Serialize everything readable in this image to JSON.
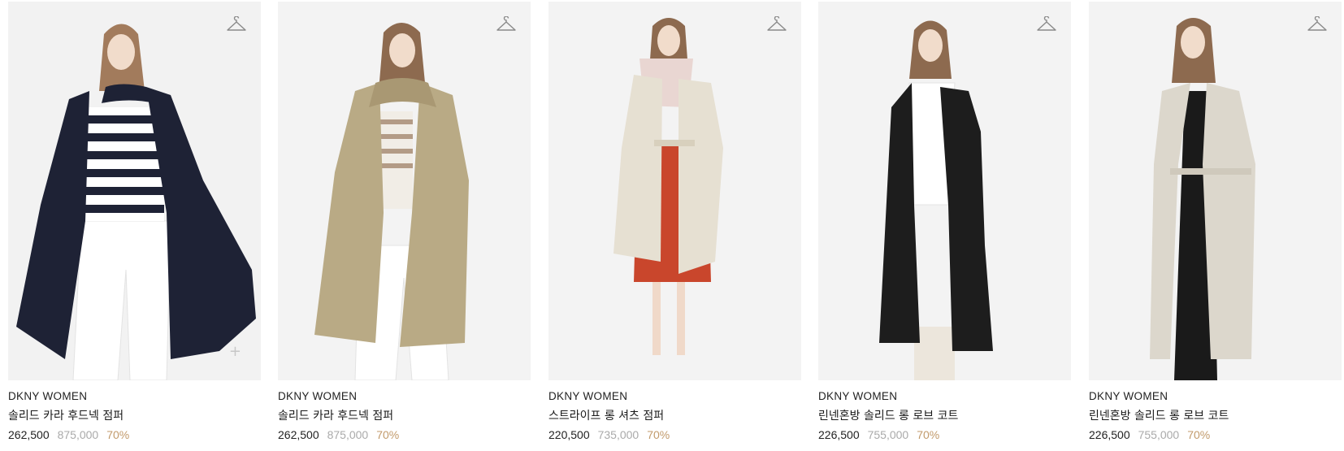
{
  "products": [
    {
      "brand": "DKNY WOMEN",
      "name": "솔리드 카라 후드넥 점퍼",
      "price_sale": "262,500",
      "price_original": "875,000",
      "discount": "70%",
      "colors": {
        "bg": "#f2f2f2",
        "garment": "#1e2235",
        "inner": "#ffffff",
        "pants": "#ffffff",
        "hair": "#a27b5c",
        "stripe": "#1e2235"
      },
      "has_plus": true
    },
    {
      "brand": "DKNY WOMEN",
      "name": "솔리드 카라 후드넥 점퍼",
      "price_sale": "262,500",
      "price_original": "875,000",
      "discount": "70%",
      "colors": {
        "bg": "#f3f3f3",
        "garment": "#b9aa85",
        "inner": "#f1ede6",
        "pants": "#ffffff",
        "hair": "#8d6a4f",
        "stripe": "#b39b86"
      },
      "has_plus": false
    },
    {
      "brand": "DKNY WOMEN",
      "name": "스트라이프 롱 셔츠 점퍼",
      "price_sale": "220,500",
      "price_original": "735,000",
      "discount": "70%",
      "colors": {
        "bg": "#f3f3f3",
        "garment": "#e6e0d2",
        "inner": "#c9462c",
        "pants": "#f0d9c9",
        "hair": "#8d6a4f",
        "stripe": "#e9d6d2"
      },
      "has_plus": false
    },
    {
      "brand": "DKNY WOMEN",
      "name": "린넨혼방 솔리드 롱 로브 코트",
      "price_sale": "226,500",
      "price_original": "755,000",
      "discount": "70%",
      "colors": {
        "bg": "#f3f3f3",
        "garment": "#1d1d1d",
        "inner": "#ffffff",
        "pants": "#ece6dc",
        "hair": "#8d6a4f",
        "stripe": "#1d1d1d"
      },
      "has_plus": false
    },
    {
      "brand": "DKNY WOMEN",
      "name": "린넨혼방 솔리드 롱 로브 코트",
      "price_sale": "226,500",
      "price_original": "755,000",
      "discount": "70%",
      "colors": {
        "bg": "#f3f3f3",
        "garment": "#dcd7cc",
        "inner": "#1a1a1a",
        "pants": "#1a1a1a",
        "hair": "#8d6a4f",
        "stripe": "#dcd7cc"
      },
      "has_plus": false
    }
  ],
  "icons": {
    "wishlist": "hanger-icon",
    "add": "plus-icon"
  },
  "accent": {
    "discount": "#c29a6b",
    "original_price": "#aaaaaa"
  }
}
